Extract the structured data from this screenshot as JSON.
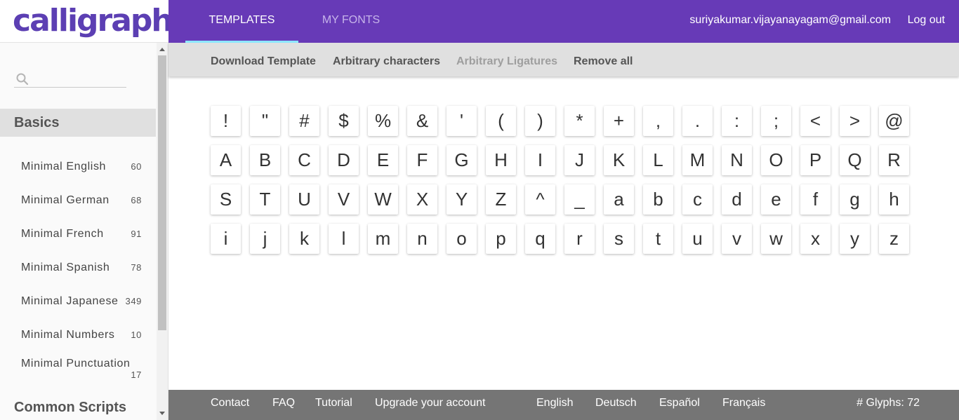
{
  "app": {
    "logo_text": "calligraphr"
  },
  "header": {
    "tabs": [
      {
        "label": "TEMPLATES",
        "active": true
      },
      {
        "label": "MY FONTS",
        "active": false
      }
    ],
    "user_email": "suriyakumar.vijayanayagam@gmail.com",
    "logout_label": "Log out"
  },
  "toolbar": {
    "download_template": "Download Template",
    "arbitrary_characters": "Arbitrary characters",
    "arbitrary_ligatures": "Arbitrary Ligatures",
    "remove_all": "Remove all"
  },
  "sidebar": {
    "search": {
      "placeholder": "",
      "value": "",
      "icon": "search-icon"
    },
    "sections": [
      {
        "title": "Basics",
        "items": [
          {
            "label": "Minimal English",
            "count": "60"
          },
          {
            "label": "Minimal German",
            "count": "68"
          },
          {
            "label": "Minimal French",
            "count": "91"
          },
          {
            "label": "Minimal Spanish",
            "count": "78"
          },
          {
            "label": "Minimal Japanese",
            "count": "349"
          },
          {
            "label": "Minimal Numbers",
            "count": "10"
          },
          {
            "label": "Minimal Punctuation",
            "count": "17"
          }
        ]
      },
      {
        "title": "Common Scripts",
        "items": []
      }
    ]
  },
  "glyph_rows": [
    [
      "!",
      "\"",
      "#",
      "$",
      "%",
      "&",
      "'",
      "(",
      ")",
      "*",
      "+",
      ",",
      ".",
      ":",
      ";",
      "<",
      ">",
      "@"
    ],
    [
      "A",
      "B",
      "C",
      "D",
      "E",
      "F",
      "G",
      "H",
      "I",
      "J",
      "K",
      "L",
      "M",
      "N",
      "O",
      "P",
      "Q",
      "R"
    ],
    [
      "S",
      "T",
      "U",
      "V",
      "W",
      "X",
      "Y",
      "Z",
      "^",
      "_",
      "a",
      "b",
      "c",
      "d",
      "e",
      "f",
      "g",
      "h"
    ],
    [
      "i",
      "j",
      "k",
      "l",
      "m",
      "n",
      "o",
      "p",
      "q",
      "r",
      "s",
      "t",
      "u",
      "v",
      "w",
      "x",
      "y",
      "z"
    ]
  ],
  "footer": {
    "links": [
      "Contact",
      "FAQ",
      "Tutorial",
      "Upgrade your account"
    ],
    "languages": [
      "English",
      "Deutsch",
      "Español",
      "Français"
    ],
    "glyph_count": "# Glyphs: 72"
  },
  "colors": {
    "brand_purple": "#673ab7",
    "tab_indicator": "#8ee8ff",
    "footer_gray": "#757575",
    "toolbar_gray": "#e0e0e0"
  }
}
